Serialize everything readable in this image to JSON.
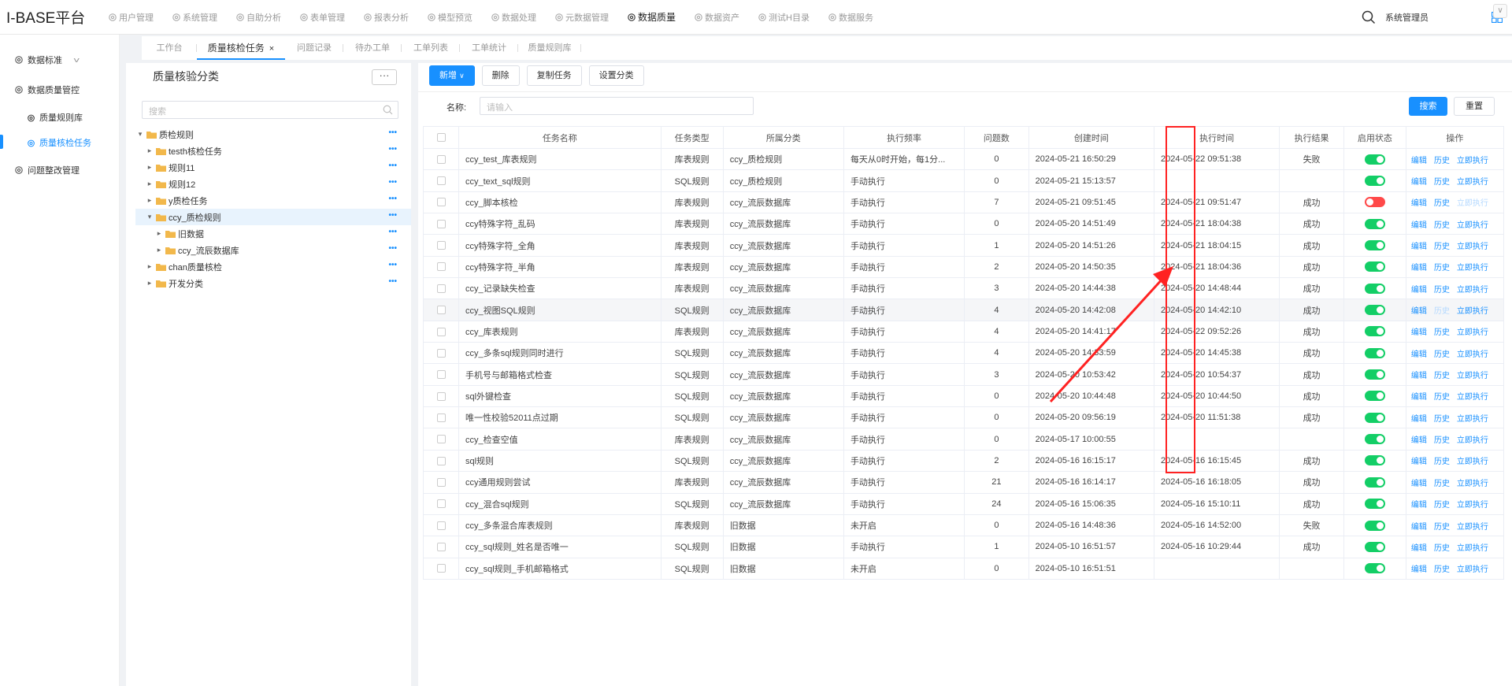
{
  "brand": "I-BASE平台",
  "topnav": [
    {
      "label": "用户管理",
      "icon": "gear-icon",
      "active": false
    },
    {
      "label": "系统管理",
      "icon": "bar-chart-icon",
      "active": false
    },
    {
      "label": "自助分析",
      "icon": "monitor-icon",
      "active": false
    },
    {
      "label": "表单管理",
      "icon": "form-icon",
      "active": false
    },
    {
      "label": "报表分析",
      "icon": "gear-icon",
      "active": false
    },
    {
      "label": "模型预览",
      "icon": "gear-icon",
      "active": false
    },
    {
      "label": "数据处理",
      "icon": "gear-icon",
      "active": false
    },
    {
      "label": "元数据管理",
      "icon": "gear-icon",
      "active": false
    },
    {
      "label": "数据质量",
      "icon": "gear-icon",
      "active": true
    },
    {
      "label": "数据资产",
      "icon": "gear-icon",
      "active": false
    },
    {
      "label": "测试H目录",
      "icon": "gear-icon",
      "active": false
    },
    {
      "label": "数据服务",
      "icon": "gear-icon",
      "active": false
    }
  ],
  "user": {
    "name": "系统管理员"
  },
  "tabs": [
    {
      "label": "工作台",
      "active": false
    },
    {
      "label": "质量核检任务",
      "active": true
    },
    {
      "label": "问题记录",
      "active": false
    },
    {
      "label": "待办工单",
      "active": false
    },
    {
      "label": "工单列表",
      "active": false
    },
    {
      "label": "工单统计",
      "active": false
    },
    {
      "label": "质量规则库",
      "active": false
    }
  ],
  "sidebar": {
    "groups": [
      {
        "label": "数据标准",
        "expanded": false,
        "items": []
      },
      {
        "label": "数据质量管控",
        "expanded": true,
        "items": [
          {
            "label": "质量规则库",
            "active": false
          },
          {
            "label": "质量核检任务",
            "active": true
          }
        ]
      },
      {
        "label": "问题整改管理",
        "expanded": false,
        "items": []
      }
    ]
  },
  "tree_panel": {
    "title": "质量核验分类",
    "more_label": "···",
    "search_placeholder": "搜索",
    "nodes": [
      {
        "label": "质检规则",
        "level": 0,
        "expanded": true,
        "selected": false
      },
      {
        "label": "testh核检任务",
        "level": 1,
        "expanded": false,
        "selected": false
      },
      {
        "label": "规则11",
        "level": 1,
        "expanded": false,
        "selected": false
      },
      {
        "label": "规则12",
        "level": 1,
        "expanded": false,
        "selected": false
      },
      {
        "label": "y质检任务",
        "level": 1,
        "expanded": false,
        "selected": false
      },
      {
        "label": "ccy_质检规则",
        "level": 1,
        "expanded": true,
        "selected": true
      },
      {
        "label": "旧数据",
        "level": 2,
        "expanded": false,
        "selected": false
      },
      {
        "label": "ccy_流辰数据库",
        "level": 2,
        "expanded": false,
        "selected": false
      },
      {
        "label": "chan质量核检",
        "level": 1,
        "expanded": false,
        "selected": false
      },
      {
        "label": "开发分类",
        "level": 1,
        "expanded": false,
        "selected": false
      }
    ]
  },
  "toolbar": {
    "add_label": "新增",
    "delete_label": "删除",
    "copy_label": "复制任务",
    "category_label": "设置分类"
  },
  "filter": {
    "name_label": "名称:",
    "name_placeholder": "请输入",
    "search_label": "搜索",
    "reset_label": "重置"
  },
  "table": {
    "columns": [
      "任务名称",
      "任务类型",
      "所属分类",
      "执行频率",
      "问题数",
      "创建时间",
      "执行时间",
      "执行结果",
      "启用状态",
      "操作"
    ],
    "op_labels": {
      "edit": "编辑",
      "history": "历史",
      "run": "立即执行"
    },
    "rows": [
      {
        "name": "ccy_test_库表规则",
        "type": "库表规则",
        "category": "ccy_质检规则",
        "freq": "每天从0时开始，每1分...",
        "issues": "0",
        "created": "2024-05-21 16:50:29",
        "executed": "2024-05-22 09:51:38",
        "result": "失败",
        "enabled": true,
        "hl": false
      },
      {
        "name": "ccy_text_sql规则",
        "type": "SQL规则",
        "category": "ccy_质检规则",
        "freq": "手动执行",
        "issues": "0",
        "created": "2024-05-21 15:13:57",
        "executed": "",
        "result": "",
        "enabled": true,
        "hl": false
      },
      {
        "name": "ccy_脚本核检",
        "type": "库表规则",
        "category": "ccy_流辰数据库",
        "freq": "手动执行",
        "issues": "7",
        "created": "2024-05-21 09:51:45",
        "executed": "2024-05-21 09:51:47",
        "result": "成功",
        "enabled": false,
        "hl": false
      },
      {
        "name": "ccy特殊字符_乱码",
        "type": "库表规则",
        "category": "ccy_流辰数据库",
        "freq": "手动执行",
        "issues": "0",
        "created": "2024-05-20 14:51:49",
        "executed": "2024-05-21 18:04:38",
        "result": "成功",
        "enabled": true,
        "hl": false
      },
      {
        "name": "ccy特殊字符_全角",
        "type": "库表规则",
        "category": "ccy_流辰数据库",
        "freq": "手动执行",
        "issues": "1",
        "created": "2024-05-20 14:51:26",
        "executed": "2024-05-21 18:04:15",
        "result": "成功",
        "enabled": true,
        "hl": false
      },
      {
        "name": "ccy特殊字符_半角",
        "type": "库表规则",
        "category": "ccy_流辰数据库",
        "freq": "手动执行",
        "issues": "2",
        "created": "2024-05-20 14:50:35",
        "executed": "2024-05-21 18:04:36",
        "result": "成功",
        "enabled": true,
        "hl": false
      },
      {
        "name": "ccy_记录缺失检查",
        "type": "库表规则",
        "category": "ccy_流辰数据库",
        "freq": "手动执行",
        "issues": "3",
        "created": "2024-05-20 14:44:38",
        "executed": "2024-05-20 14:48:44",
        "result": "成功",
        "enabled": true,
        "hl": false
      },
      {
        "name": "ccy_视图SQL规则",
        "type": "SQL规则",
        "category": "ccy_流辰数据库",
        "freq": "手动执行",
        "issues": "4",
        "created": "2024-05-20 14:42:08",
        "executed": "2024-05-20 14:42:10",
        "result": "成功",
        "enabled": true,
        "hl": true
      },
      {
        "name": "ccy_库表规则",
        "type": "库表规则",
        "category": "ccy_流辰数据库",
        "freq": "手动执行",
        "issues": "4",
        "created": "2024-05-20 14:41:17",
        "executed": "2024-05-22 09:52:26",
        "result": "成功",
        "enabled": true,
        "hl": false
      },
      {
        "name": "ccy_多条sql规则同时进行",
        "type": "SQL规则",
        "category": "ccy_流辰数据库",
        "freq": "手动执行",
        "issues": "4",
        "created": "2024-05-20 14:33:59",
        "executed": "2024-05-20 14:45:38",
        "result": "成功",
        "enabled": true,
        "hl": false
      },
      {
        "name": "手机号与邮箱格式检查",
        "type": "SQL规则",
        "category": "ccy_流辰数据库",
        "freq": "手动执行",
        "issues": "3",
        "created": "2024-05-20 10:53:42",
        "executed": "2024-05-20 10:54:37",
        "result": "成功",
        "enabled": true,
        "hl": false
      },
      {
        "name": "sql外键检查",
        "type": "SQL规则",
        "category": "ccy_流辰数据库",
        "freq": "手动执行",
        "issues": "0",
        "created": "2024-05-20 10:44:48",
        "executed": "2024-05-20 10:44:50",
        "result": "成功",
        "enabled": true,
        "hl": false
      },
      {
        "name": "唯一性校验52011点过期",
        "type": "SQL规则",
        "category": "ccy_流辰数据库",
        "freq": "手动执行",
        "issues": "0",
        "created": "2024-05-20 09:56:19",
        "executed": "2024-05-20 11:51:38",
        "result": "成功",
        "enabled": true,
        "hl": false
      },
      {
        "name": "ccy_检查空值",
        "type": "库表规则",
        "category": "ccy_流辰数据库",
        "freq": "手动执行",
        "issues": "0",
        "created": "2024-05-17 10:00:55",
        "executed": "",
        "result": "",
        "enabled": true,
        "hl": false
      },
      {
        "name": "sql规则",
        "type": "SQL规则",
        "category": "ccy_流辰数据库",
        "freq": "手动执行",
        "issues": "2",
        "created": "2024-05-16 16:15:17",
        "executed": "2024-05-16 16:15:45",
        "result": "成功",
        "enabled": true,
        "hl": false
      },
      {
        "name": "ccy通用规则尝试",
        "type": "库表规则",
        "category": "ccy_流辰数据库",
        "freq": "手动执行",
        "issues": "21",
        "created": "2024-05-16 16:14:17",
        "executed": "2024-05-16 16:18:05",
        "result": "成功",
        "enabled": true,
        "hl": false
      },
      {
        "name": "ccy_混合sql规则",
        "type": "SQL规则",
        "category": "ccy_流辰数据库",
        "freq": "手动执行",
        "issues": "24",
        "created": "2024-05-16 15:06:35",
        "executed": "2024-05-16 15:10:11",
        "result": "成功",
        "enabled": true,
        "hl": false
      },
      {
        "name": "ccy_多条混合库表规则",
        "type": "库表规则",
        "category": "旧数据",
        "freq": "未开启",
        "issues": "0",
        "created": "2024-05-16 14:48:36",
        "executed": "2024-05-16 14:52:00",
        "result": "失败",
        "enabled": true,
        "hl": false
      },
      {
        "name": "ccy_sql规则_姓名是否唯一",
        "type": "SQL规则",
        "category": "旧数据",
        "freq": "手动执行",
        "issues": "1",
        "created": "2024-05-10 16:51:57",
        "executed": "2024-05-16 10:29:44",
        "result": "成功",
        "enabled": true,
        "hl": false
      },
      {
        "name": "ccy_sql规则_手机邮箱格式",
        "type": "SQL规则",
        "category": "旧数据",
        "freq": "未开启",
        "issues": "0",
        "created": "2024-05-10 16:51:51",
        "executed": "",
        "result": "",
        "enabled": true,
        "hl": false
      }
    ]
  },
  "colors": {
    "accent": "#1890ff",
    "switch_on": "#13ce66",
    "switch_off": "#ff4949",
    "annotation": "#ff2222"
  }
}
